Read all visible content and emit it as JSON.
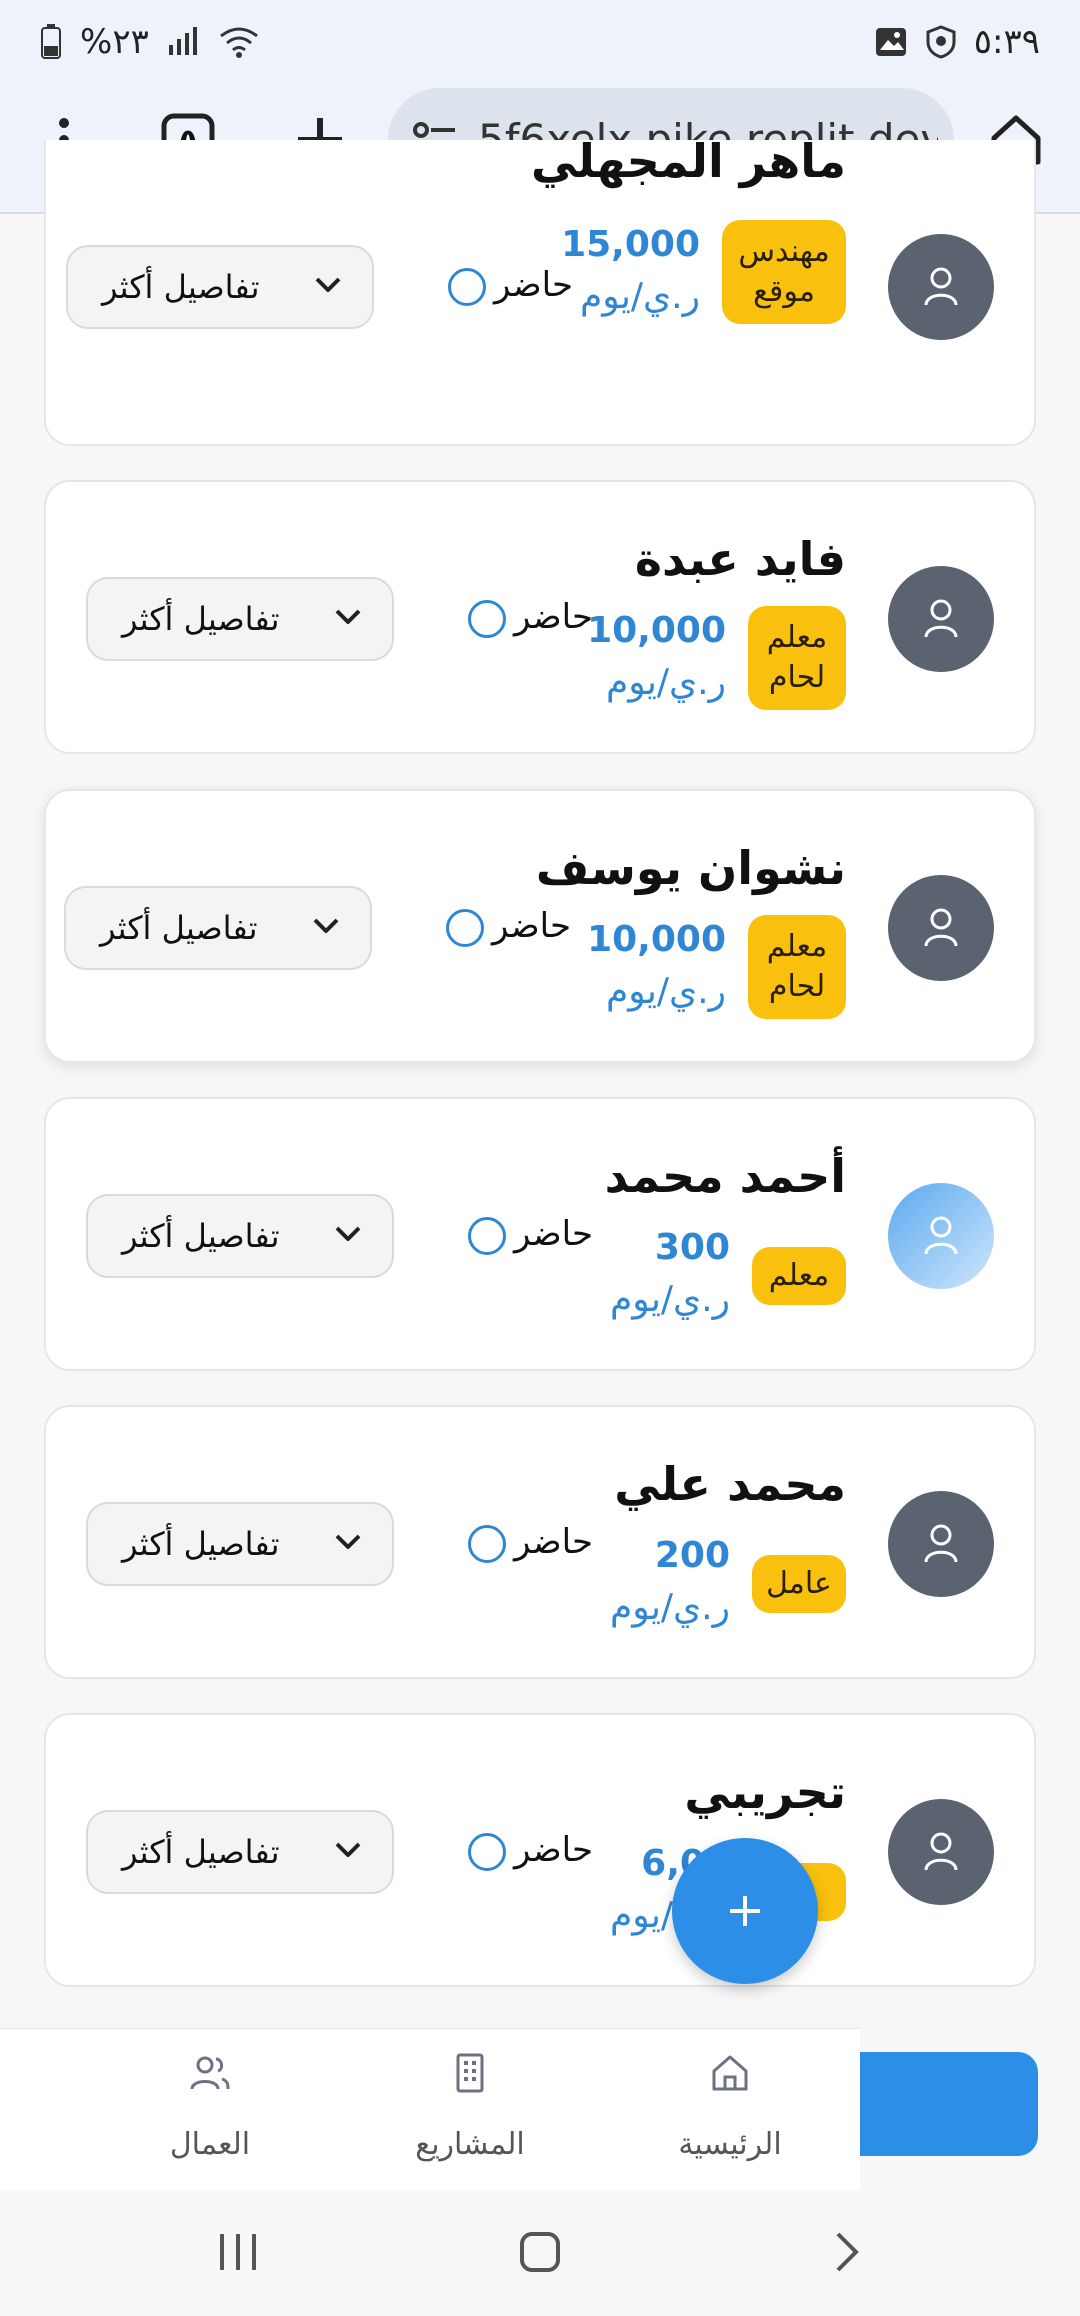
{
  "status_bar": {
    "battery_text": "%٢٣",
    "time": "٥:٣٩"
  },
  "browser": {
    "url": "5f6xelx.pike.replit.dev",
    "tab_count": "٥"
  },
  "workers": [
    {
      "name": "ماهر المجهلي",
      "role": "مهندس موقع",
      "wage": "15,000",
      "unit": "ر.ي/يوم",
      "present_label": "حاضر",
      "details_label": "تفاصيل أكثر"
    },
    {
      "name": "فايد عبدة",
      "role": "معلم لحام",
      "wage": "10,000",
      "unit": "ر.ي/يوم",
      "present_label": "حاضر",
      "details_label": "تفاصيل أكثر"
    },
    {
      "name": "نشوان يوسف",
      "role": "معلم لحام",
      "wage": "10,000",
      "unit": "ر.ي/يوم",
      "present_label": "حاضر",
      "details_label": "تفاصيل أكثر"
    },
    {
      "name": "أحمد محمد",
      "role": "معلم",
      "wage": "300",
      "unit": "ر.ي/يوم",
      "present_label": "حاضر",
      "details_label": "تفاصيل أكثر"
    },
    {
      "name": "محمد علي",
      "role": "عامل",
      "wage": "200",
      "unit": "ر.ي/يوم",
      "present_label": "حاضر",
      "details_label": "تفاصيل أكثر"
    },
    {
      "name": "تجريبي",
      "role": "عا",
      "wage": "6,00",
      "unit": "ر.ي/يوم",
      "present_label": "حاضر",
      "details_label": "تفاصيل أكثر"
    }
  ],
  "fab": {
    "icon": "plus-icon"
  },
  "bottom_nav": {
    "home": "الرئيسية",
    "projects": "المشاريع",
    "workers": "العمال"
  },
  "colors": {
    "accent": "#2d8ee8",
    "badge": "#f9c10d",
    "wage_text": "#2f86d5",
    "avatar": "#5c6370"
  }
}
